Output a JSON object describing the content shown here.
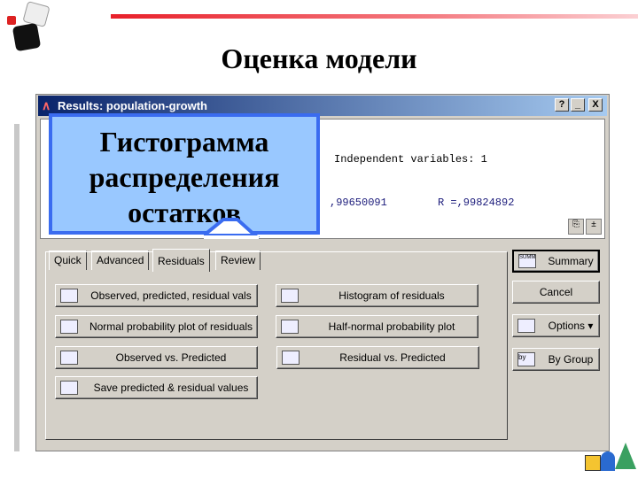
{
  "slide": {
    "title": "Оценка модели"
  },
  "window": {
    "title": "Results: population-growth",
    "help": "?",
    "minimize": "_",
    "close": "X"
  },
  "results": {
    "independent": "Independent variables: 1",
    "r2": ",99650091",
    "r": "R =,99824892"
  },
  "tabs": [
    {
      "label": "Quick"
    },
    {
      "label": "Advanced"
    },
    {
      "label": "Residuals",
      "active": true
    },
    {
      "label": "Review"
    }
  ],
  "buttons_left": [
    {
      "label": "Observed, predicted, residual vals",
      "icon": "spreadsheet-icon"
    },
    {
      "label": "Normal probability plot of residuals",
      "icon": "normal-plot-icon"
    },
    {
      "label": "Observed vs. Predicted",
      "icon": "scatter-plot-icon"
    },
    {
      "label": "Save predicted & residual values",
      "icon": "save-spreadsheet-icon"
    }
  ],
  "buttons_right": [
    {
      "label": "Histogram of residuals",
      "icon": "histogram-icon"
    },
    {
      "label": "Half-normal probability plot",
      "icon": "normal-plot-icon"
    },
    {
      "label": "Residual vs. Predicted",
      "icon": "scatter-plot-icon"
    }
  ],
  "side": {
    "summary": "Summary",
    "summary_icon": "SUMM",
    "cancel": "Cancel",
    "options": "Options ▾",
    "bygroup": "By Group",
    "bygroup_icon": "by"
  },
  "callout": {
    "line1": "Гистограмма",
    "line2": "распределения",
    "line3": "остатков"
  },
  "colors": {
    "callout_fill": "#99c8ff",
    "callout_border": "#3a6cf0",
    "accent_line": "#e8202a"
  }
}
